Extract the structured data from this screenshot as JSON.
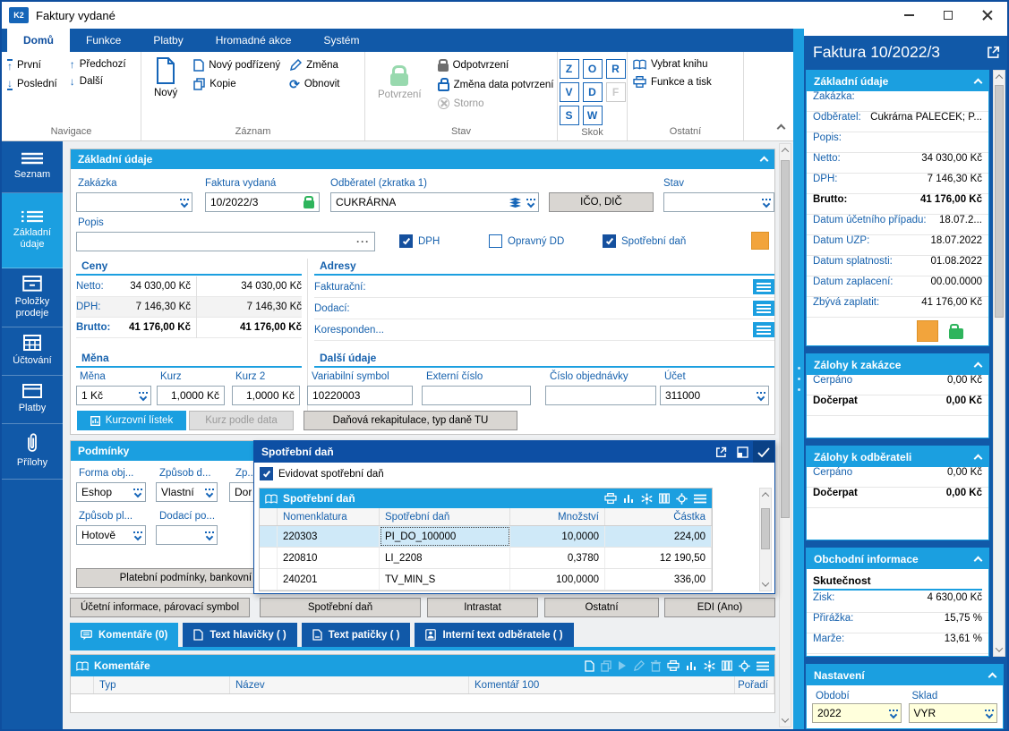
{
  "window": {
    "title": "Faktury vydané",
    "logo": "K2"
  },
  "ribbon": {
    "tabs": [
      {
        "label": "Domů"
      },
      {
        "label": "Funkce"
      },
      {
        "label": "Platby"
      },
      {
        "label": "Hromadné akce"
      },
      {
        "label": "Systém"
      }
    ],
    "navigace": {
      "label": "Navigace",
      "first": "První",
      "last": "Poslední",
      "prev": "Předchozí",
      "next": "Další"
    },
    "zaznam": {
      "label": "Záznam",
      "new": "Nový",
      "new_child": "Nový podřízený",
      "copy": "Kopie",
      "change": "Změna",
      "refresh": "Obnovit"
    },
    "stav": {
      "label": "Stav",
      "confirm": "Potvrzení",
      "unconfirm": "Odpotvrzení",
      "change_date": "Změna data potvrzení",
      "storno": "Storno"
    },
    "skok": {
      "label": "Skok",
      "keys": [
        "Z",
        "O",
        "R",
        "V",
        "D",
        "F",
        "S",
        "W"
      ]
    },
    "ostatni": {
      "label": "Ostatní",
      "select_book": "Vybrat knihu",
      "functions_print": "Funkce a tisk"
    }
  },
  "sidebar": {
    "items": [
      {
        "label": "Seznam"
      },
      {
        "label": "Základní údaje"
      },
      {
        "label": "Položky prodeje"
      },
      {
        "label": "Účtování"
      },
      {
        "label": "Platby"
      },
      {
        "label": "Přílohy"
      }
    ]
  },
  "basic": {
    "title": "Základní údaje",
    "zakazka_label": "Zakázka",
    "zakazka_value": "",
    "faktura_label": "Faktura vydaná",
    "faktura_value": "10/2022/3",
    "odberatel_label": "Odběratel (zkratka 1)",
    "odberatel_value": "CUKRÁRNA",
    "ico_dic_button": "IČO, DIČ",
    "stav_label": "Stav",
    "stav_value": "",
    "popis_label": "Popis",
    "popis_value": "",
    "popis_more": "···",
    "dph_label": "DPH",
    "opravny_label": "Opravný DD",
    "spotrebni_label": "Spotřební daň",
    "ceny": {
      "title": "Ceny",
      "rows": [
        {
          "label": "Netto:",
          "v1": "34 030,00 Kč",
          "v2": "34 030,00 Kč"
        },
        {
          "label": "DPH:",
          "v1": "7 146,30 Kč",
          "v2": "7 146,30 Kč"
        },
        {
          "label": "Brutto:",
          "v1": "41 176,00 Kč",
          "v2": "41 176,00 Kč"
        }
      ]
    },
    "adresy": {
      "title": "Adresy",
      "rows": [
        {
          "label": "Fakturační:"
        },
        {
          "label": "Dodací:"
        },
        {
          "label": "Koresponden..."
        }
      ]
    },
    "mena": {
      "title": "Měna",
      "mena_label": "Měna",
      "mena_value": "1 Kč",
      "kurz_label": "Kurz",
      "kurz_value": "1,0000 Kč",
      "kurz2_label": "Kurz 2",
      "kurz2_value": "1,0000 Kč",
      "kurzovni_btn": "Kurzovní lístek",
      "kurzdata_btn": "Kurz podle data"
    },
    "dalsi": {
      "title": "Další údaje",
      "vs_label": "Variabilní symbol",
      "vs_value": "10220003",
      "ext_label": "Externí číslo",
      "ext_value": "",
      "obj_label": "Číslo objednávky",
      "obj_value": "",
      "ucet_label": "Účet",
      "ucet_value": "311000",
      "danova_btn": "Daňová rekapitulace, typ daně TU"
    }
  },
  "podminky": {
    "title": "Podmínky",
    "forma_label": "Forma obj...",
    "forma_value": "Eshop",
    "zpusob_d_label": "Způsob d...",
    "zpusob_d_value": "Vlastní",
    "zp_label": "Zp...",
    "zp_value": "Dor",
    "zpusob_pl_label": "Způsob pl...",
    "zpusob_pl_value": "Hotově",
    "dodaci_label": "Dodací po...",
    "dodaci_value": "",
    "platebni_btn": "Platební podmínky, bankovní úč"
  },
  "popup": {
    "title": "Spotřební daň",
    "evidovat_label": "Evidovat spotřební daň",
    "grid_title": "Spotřební daň",
    "columns": [
      "Nomenklatura",
      "Spotřební daň",
      "Množství",
      "Částka"
    ],
    "rows": [
      [
        "220303",
        "PI_DO_100000",
        "10,0000",
        "224,00"
      ],
      [
        "220810",
        "LI_2208",
        "0,3780",
        "12 190,50"
      ],
      [
        "240201",
        "TV_MIN_S",
        "100,0000",
        "336,00"
      ]
    ]
  },
  "bottom_buttons": [
    "Účetní informace, párovací symbol",
    "Spotřební daň",
    "Intrastat",
    "Ostatní",
    "EDI (Ano)"
  ],
  "tabs": [
    {
      "label": "Komentáře (0)"
    },
    {
      "label": "Text hlavičky ( )"
    },
    {
      "label": "Text patičky ( )"
    },
    {
      "label": "Interní text odběratele ( )"
    }
  ],
  "comments": {
    "title": "Komentáře",
    "columns": [
      "Typ",
      "Název",
      "Komentář 100",
      "Pořadí"
    ]
  },
  "panel": {
    "title": "Faktura 10/2022/3",
    "basic": {
      "title": "Základní údaje",
      "rows": [
        {
          "label": "Zakázka:",
          "value": ""
        },
        {
          "label": "Odběratel:",
          "value": "Cukrárna PALEČEK; P..."
        },
        {
          "label": "Popis:",
          "value": ""
        },
        {
          "label": "Netto:",
          "value": "34 030,00 Kč"
        },
        {
          "label": "DPH:",
          "value": "7 146,30 Kč"
        },
        {
          "label": "Brutto:",
          "value": "41 176,00 Kč"
        },
        {
          "label": "Datum účetního případu:",
          "value": "18.07.2..."
        },
        {
          "label": "Datum UZP:",
          "value": "18.07.2022"
        },
        {
          "label": "Datum splatnosti:",
          "value": "01.08.2022"
        },
        {
          "label": "Datum zaplacení:",
          "value": "00.00.0000"
        },
        {
          "label": "Zbývá zaplatit:",
          "value": "41 176,00 Kč"
        }
      ]
    },
    "zalohy_zakazka": {
      "title": "Zálohy k zakázce",
      "cerpano_label": "Čerpáno",
      "cerpano_value": "0,00 Kč",
      "docerpat_label": "Dočerpat",
      "docerpat_value": "0,00 Kč"
    },
    "zalohy_odberatel": {
      "title": "Zálohy k odběrateli",
      "cerpano_label": "Čerpáno",
      "cerpano_value": "0,00 Kč",
      "docerpat_label": "Dočerpat",
      "docerpat_value": "0,00 Kč"
    },
    "obchodni": {
      "title": "Obchodní informace",
      "sub": "Skutečnost",
      "rows": [
        {
          "label": "Zisk:",
          "value": "4 630,00 Kč"
        },
        {
          "label": "Přirážka:",
          "value": "15,75 %"
        },
        {
          "label": "Marže:",
          "value": "13,61 %"
        }
      ]
    },
    "nastaveni": {
      "title": "Nastavení",
      "obdobi_label": "Období",
      "obdobi_value": "2022",
      "sklad_label": "Sklad",
      "sklad_value": "VYR"
    }
  },
  "colors": {
    "ribbon_blue": "#1159a8",
    "cyan_accent": "#1b9fe0",
    "popup_header_blue": "#0d4fa4",
    "label_blue": "#1661ad",
    "orange_indicator": "#f2a43c",
    "green_lock": "#2eb45c",
    "yellow_field": "#ffffdc",
    "selected_row": "#cfe9f8"
  }
}
